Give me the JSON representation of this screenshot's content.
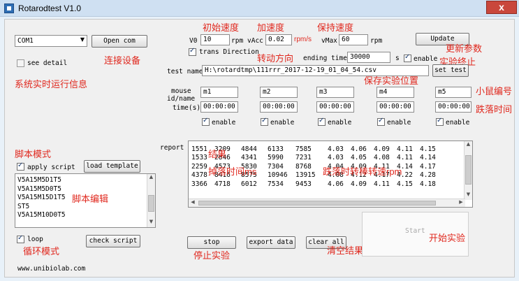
{
  "window": {
    "title": "Rotarodtest V1.0",
    "close_label": "x",
    "app_icon": "app-icon"
  },
  "connection": {
    "port": "COM1",
    "open_label": "Open com",
    "see_detail_label": "see detail",
    "see_detail_checked": false
  },
  "params": {
    "v0_label": "V0",
    "v0": "10",
    "v0_unit": "rpm",
    "vacc_label": "vAcc",
    "vacc": "0.02",
    "vacc_unit": "rpm/s",
    "vmax_label": "vMax",
    "vmax": "60",
    "vmax_unit": "rpm",
    "update_label": "Update",
    "trans_direction_label": "trans Direction",
    "trans_direction_checked": true,
    "ending_time_label": "ending time",
    "ending_time": "30000",
    "ending_time_unit": "s",
    "enable_label": "enable",
    "enable_checked": true,
    "test_name_label": "test name",
    "test_name": "H:\\rotardtmp\\111rrr_2017-12-19_01_04_54.csv",
    "set_test_label": "set test"
  },
  "mice": {
    "id_label_line1": "mouse",
    "id_label_line2": "id/name",
    "time_label": "time(s)",
    "enable_label": "enable",
    "items": [
      {
        "name": "m1",
        "time": "00:00:00",
        "enabled": true
      },
      {
        "name": "m2",
        "time": "00:00:00",
        "enabled": true
      },
      {
        "name": "m3",
        "time": "00:00:00",
        "enabled": true
      },
      {
        "name": "m4",
        "time": "00:00:00",
        "enabled": true
      },
      {
        "name": "m5",
        "time": "00:00:00",
        "enabled": true
      }
    ]
  },
  "script": {
    "apply_label": "apply script",
    "apply_checked": true,
    "load_template_label": "load template",
    "lines": [
      "V5A15M5D1T5",
      "V5A15M5D0T5",
      "V5A15M15D1T5",
      "ST5",
      "V5A15M10D0T5"
    ],
    "loop_label": "loop",
    "loop_checked": true,
    "check_label": "check script"
  },
  "report": {
    "label": "report",
    "rows": [
      [
        "1551",
        "3209",
        "4844",
        "6133",
        "7585",
        "4.03",
        "4.06",
        "4.09",
        "4.11",
        "4.15"
      ],
      [
        "1533",
        "2846",
        "4341",
        "5990",
        "7231",
        "4.03",
        "4.05",
        "4.08",
        "4.11",
        "4.14"
      ],
      [
        "2259",
        "4573",
        "5830",
        "7304",
        "8768",
        "4.04",
        "4.09",
        "4.11",
        "4.14",
        "4.17"
      ],
      [
        "4378",
        "8416",
        "8575",
        "10946",
        "13915",
        "4.08",
        "4.12",
        "4.17",
        "4.22",
        "4.28"
      ],
      [
        "3366",
        "4718",
        "6012",
        "7534",
        "9453",
        "4.06",
        "4.09",
        "4.11",
        "4.15",
        "4.18"
      ]
    ]
  },
  "actions": {
    "stop_label": "stop",
    "export_label": "export data",
    "clear_label": "clear all",
    "start_label": "Start"
  },
  "footer": {
    "website": "www.unibiolab.com"
  },
  "annotations": {
    "connect_device": "连接设备",
    "system_info": "系统实时运行信息",
    "initial_speed": "初始速度",
    "acceleration": "加速度",
    "hold_speed": "保持速度",
    "rotation_direction": "转动方向",
    "update_params": "更新参数",
    "experiment_end": "实验终止",
    "save_location": "保存实验位置",
    "mouse_id": "小鼠编号",
    "fall_time": "跌落时间",
    "script_mode": "脚本模式",
    "result": "结果",
    "fall_time_ms": "掉落时间ms",
    "fall_speed_rpm": "跌落时转棒转速rpm",
    "script_edit": "脚本编辑",
    "loop_mode": "循环模式",
    "stop_experiment": "停止实验",
    "clear_result": "清空结果",
    "start_experiment": "开始实验"
  },
  "colors": {
    "annotation": "#e0281e",
    "window_bg": "#e8f1f9",
    "close_button": "#c9473c"
  }
}
